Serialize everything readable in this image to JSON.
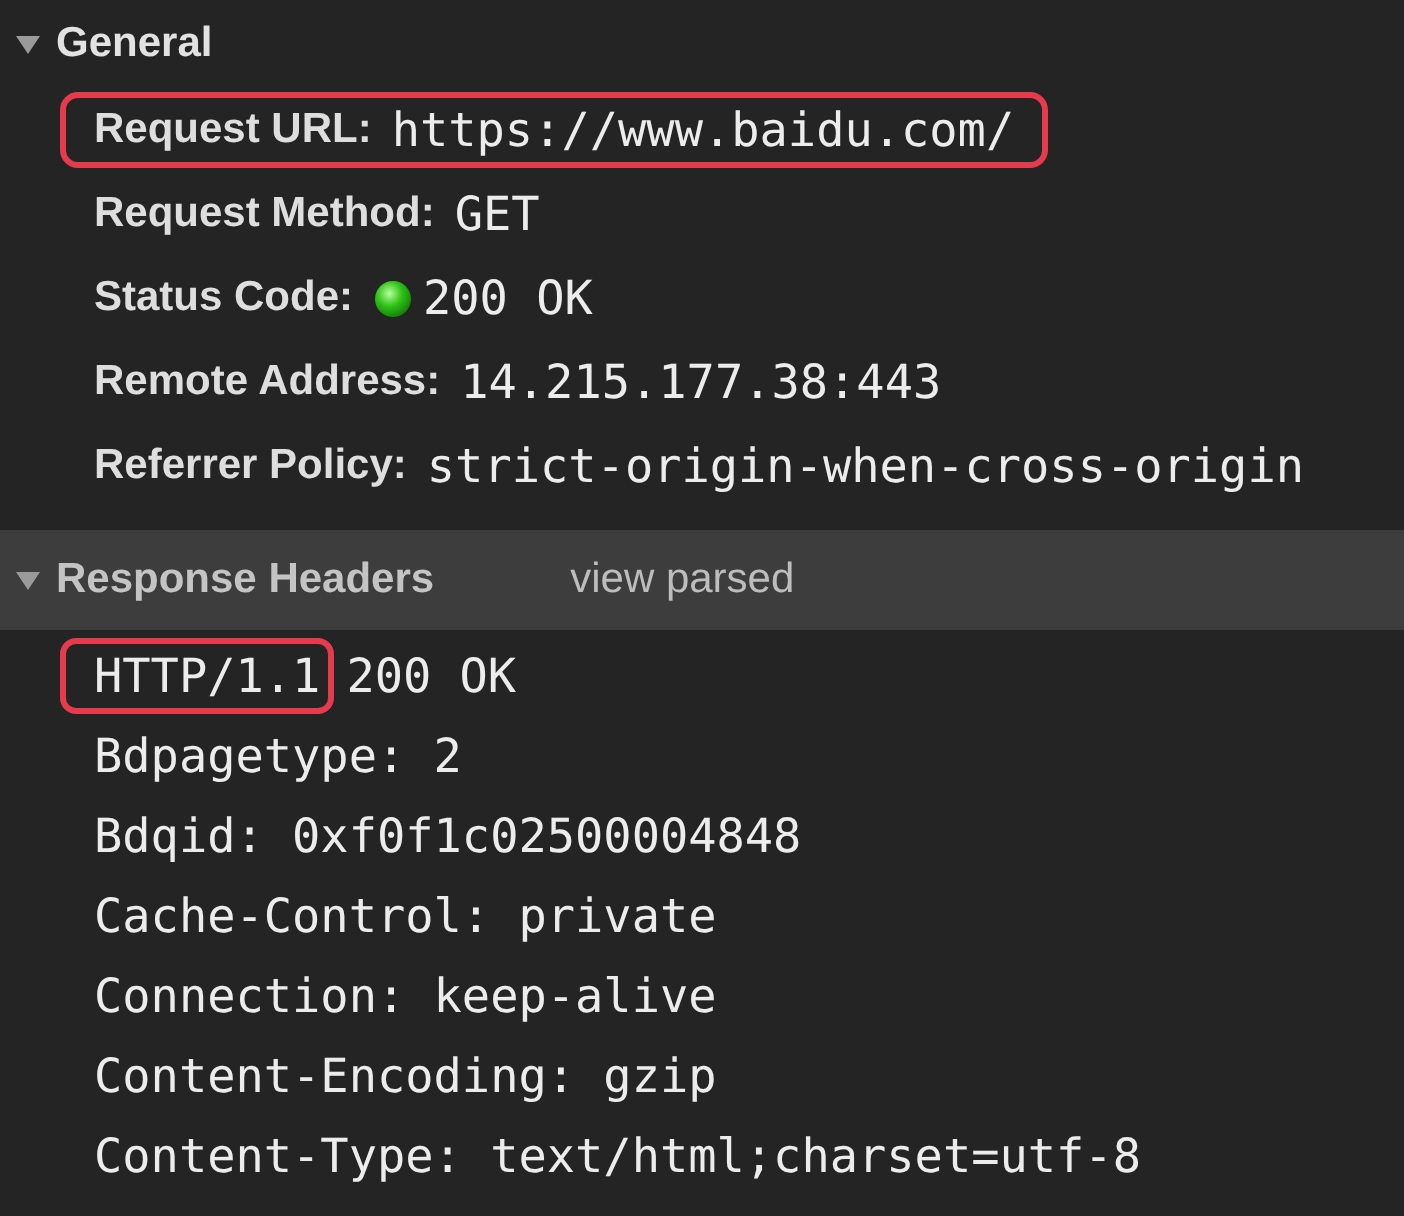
{
  "general": {
    "title": "General",
    "expanded": true,
    "rows": [
      {
        "kind": "text",
        "label": "Request URL:",
        "value": "https://www.baidu.com/",
        "highlighted": true
      },
      {
        "kind": "text",
        "label": "Request Method:",
        "value": "GET",
        "highlighted": false
      },
      {
        "kind": "status",
        "label": "Status Code:",
        "value": "200 OK",
        "highlighted": false
      },
      {
        "kind": "text",
        "label": "Remote Address:",
        "value": "14.215.177.38:443",
        "highlighted": false
      },
      {
        "kind": "text",
        "label": "Referrer Policy:",
        "value": "strict-origin-when-cross-origin",
        "highlighted": false
      }
    ]
  },
  "response_headers": {
    "title": "Response Headers",
    "expanded": true,
    "toggle_link": "view parsed",
    "status_line": {
      "protocol": "HTTP/1.1",
      "status": "200 OK",
      "highlighted": true
    },
    "lines": [
      "Bdpagetype: 2",
      "Bdqid: 0xf0f1c02500004848",
      "Cache-Control: private",
      "Connection: keep-alive",
      "Content-Encoding: gzip",
      "Content-Type: text/html;charset=utf-8"
    ]
  }
}
